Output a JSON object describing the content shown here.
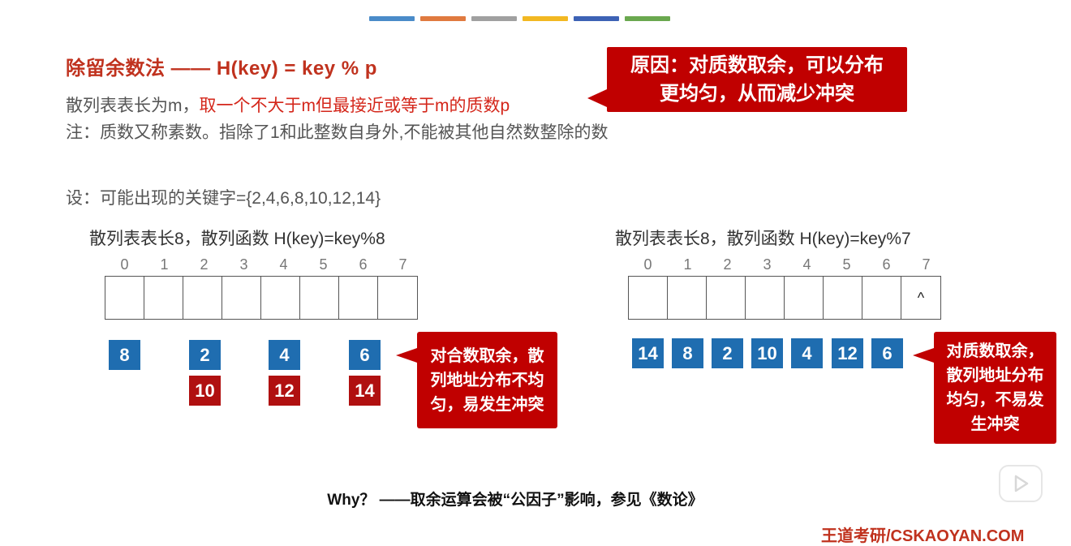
{
  "top_bar_colors": [
    "#4a8bc9",
    "#e07a3f",
    "#a0a0a0",
    "#f2b822",
    "#3d62b5",
    "#6aa84f"
  ],
  "title": "除留余数法 —— H(key) = key % p",
  "line1_prefix": "散列表表长为m，",
  "line1_highlight": "取一个不大于m但最接近或等于m的质数p",
  "line2": "注：质数又称素数。指除了1和此整数自身外,不能被其他自然数整除的数",
  "callout_top": {
    "line1": "原因：对质数取余，可以分布",
    "line2": "更均匀，从而减少冲突"
  },
  "keys_line": "设：可能出现的关键字={2,4,6,8,10,12,14}",
  "left": {
    "heading": "散列表表长8，散列函数 H(key)=key%8",
    "indices": [
      "0",
      "1",
      "2",
      "3",
      "4",
      "5",
      "6",
      "7"
    ],
    "cells": [
      "",
      "",
      "",
      "",
      "",
      "",
      "",
      ""
    ],
    "keys_row1": [
      "8",
      "2",
      "4",
      "6"
    ],
    "keys_row2": [
      "10",
      "12",
      "14"
    ],
    "callout": {
      "line1": "对合数取余，散",
      "line2": "列地址分布不均",
      "line3": "匀，易发生冲突"
    }
  },
  "right": {
    "heading": "散列表表长8，散列函数 H(key)=key%7",
    "indices": [
      "0",
      "1",
      "2",
      "3",
      "4",
      "5",
      "6",
      "7"
    ],
    "cells": [
      "",
      "",
      "",
      "",
      "",
      "",
      "",
      "^"
    ],
    "keys_row1": [
      "14",
      "8",
      "2",
      "10",
      "4",
      "12",
      "6"
    ],
    "callout": {
      "line1": "对质数取余，",
      "line2": "散列地址分布",
      "line3": "均匀，不易发",
      "line4": "生冲突"
    }
  },
  "why": "Why？ ——取余运算会被“公因子”影响，参见《数论》",
  "footer": "王道考研/CSKAOYAN.COM",
  "colors": {
    "accent_red": "#c00000",
    "key_blue": "#1f6db0",
    "key_red": "#b01010"
  }
}
